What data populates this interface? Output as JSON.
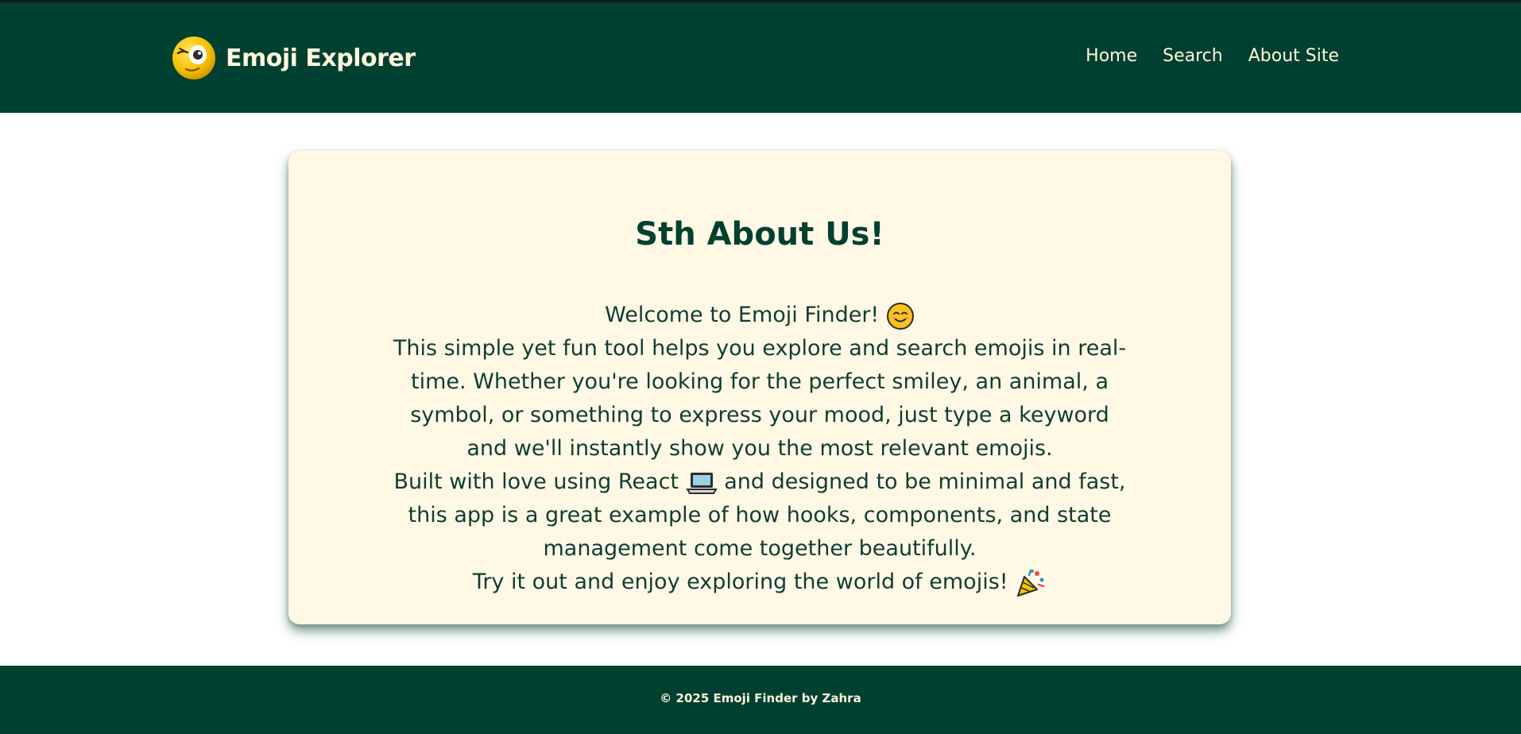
{
  "header": {
    "brand_title": "Emoji Explorer",
    "nav": [
      {
        "label": "Home"
      },
      {
        "label": "Search"
      },
      {
        "label": "About Site"
      }
    ]
  },
  "about": {
    "title": "Sth About Us!",
    "welcome": "Welcome to Emoji Finder!",
    "description": "This simple yet fun tool helps you explore and search emojis in real-time. Whether you're looking for the perfect smiley, an animal, a symbol, or something to express your mood, just type a keyword and we'll instantly show you the most relevant emojis.",
    "built_prefix": "Built with love using React",
    "built_suffix": "and designed to be minimal and fast, this app is a great example of how hooks, components, and state management come together beautifully.",
    "closing": "Try it out and enjoy exploring the world of emojis!"
  },
  "footer": {
    "copyright": "© 2025 Emoji Finder by Zahra"
  },
  "colors": {
    "header_bg": "#004030",
    "card_bg": "#fff8e5",
    "text_dark": "#0f3d33",
    "text_light": "#fff6dd"
  },
  "icons": [
    "winking-face-logo-icon",
    "smiling-face-icon",
    "laptop-icon",
    "party-popper-icon"
  ]
}
